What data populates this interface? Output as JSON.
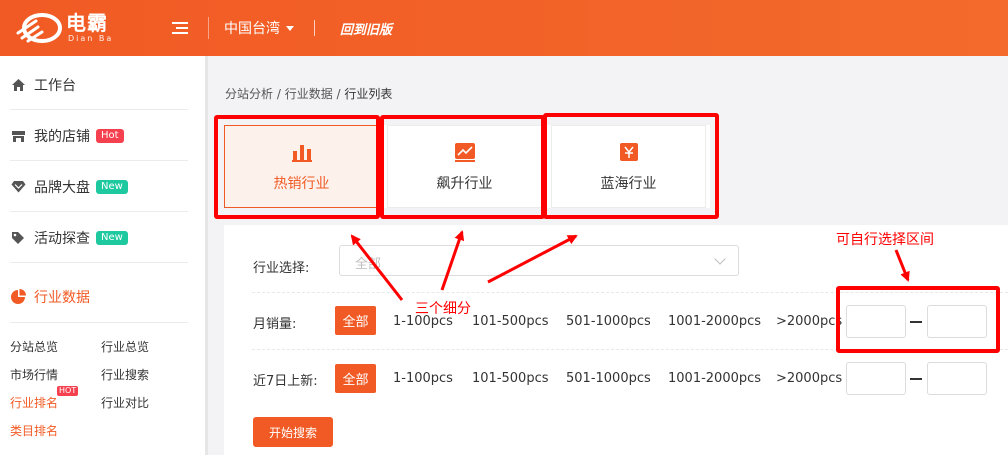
{
  "header": {
    "logo_cn": "电霸",
    "logo_en": "Dian Ba",
    "region": "中国台湾",
    "old_version": "回到旧版"
  },
  "sidebar": {
    "items": [
      {
        "label": "工作台",
        "icon": "home-icon"
      },
      {
        "label": "我的店铺",
        "icon": "store-icon",
        "badge": "Hot"
      },
      {
        "label": "品牌大盘",
        "icon": "diamond-icon",
        "badge": "New"
      },
      {
        "label": "活动探查",
        "icon": "tag-icon",
        "badge": "New"
      },
      {
        "label": "行业数据",
        "icon": "pie-chart-icon"
      }
    ],
    "sub_items": [
      "分站总览",
      "行业总览",
      "市场行情",
      "行业搜索",
      "行业排名",
      "行业对比",
      "类目排名"
    ],
    "sub_hot": "HOT"
  },
  "breadcrumb": {
    "parts": [
      "分站分析",
      "行业数据",
      "行业列表"
    ],
    "sep": " / "
  },
  "cards": [
    {
      "label": "热销行业",
      "icon": "bar-chart-icon",
      "active": true
    },
    {
      "label": "飙升行业",
      "icon": "trend-up-icon",
      "active": false
    },
    {
      "label": "蓝海行业",
      "icon": "currency-icon",
      "active": false
    }
  ],
  "filters": {
    "industry_label": "行业选择:",
    "industry_placeholder": "全部",
    "monthly_label": "月销量:",
    "new7_label": "近7日上新:",
    "all_chip": "全部",
    "ranges": [
      "1-100pcs",
      "101-500pcs",
      "501-1000pcs",
      "1001-2000pcs",
      ">2000pcs"
    ],
    "search_button": "开始搜索"
  },
  "annotations": {
    "three_segments": "三个细分",
    "custom_range": "可自行选择区间"
  },
  "colors": {
    "brand": "#f15a24",
    "annotation": "#ff0000",
    "badge_hot": "#f5404f",
    "badge_new": "#1ec9a0"
  }
}
